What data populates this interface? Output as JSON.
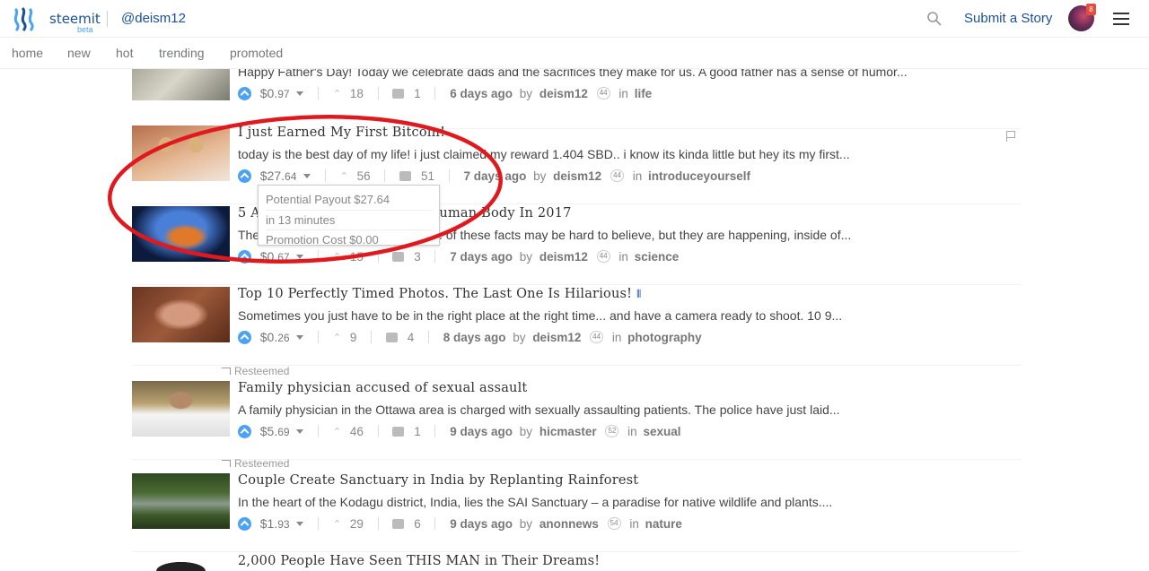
{
  "header": {
    "brand": "steemit",
    "beta": "beta",
    "username": "@deism12",
    "submit_label": "Submit a Story",
    "notification_count": "8"
  },
  "nav": {
    "items": [
      "home",
      "new",
      "hot",
      "trending",
      "promoted"
    ]
  },
  "posts": [
    {
      "title": "",
      "excerpt": "Happy Father's Day! Today we celebrate dads and the sacrifices they make for us. A good father has a sense of humor...",
      "payout_main": "$0.",
      "payout_cents": "97",
      "votes": "18",
      "comments": "1",
      "time": "6 days ago",
      "by": "by",
      "author": "deism12",
      "rep": "44",
      "in": "in",
      "category": "life"
    },
    {
      "title": "I just Earned My First Bitcoin!",
      "excerpt": "today is the best day of my life! i just claimed my reward 1.404 SBD.. i know its kinda little but hey its my first...",
      "payout_main": "$27.",
      "payout_cents": "64",
      "votes": "56",
      "comments": "51",
      "time": "7 days ago",
      "by": "by",
      "author": "deism12",
      "rep": "44",
      "in": "in",
      "category": "introduceyourself"
    },
    {
      "title": "5 Amazing Facts About The Human Body In 2017",
      "excerpt": "These facts are truly amazing. Some of these facts may be hard to believe, but they are happening, inside of...",
      "payout_main": "$0.",
      "payout_cents": "67",
      "votes": "15",
      "comments": "3",
      "time": "7 days ago",
      "by": "by",
      "author": "deism12",
      "rep": "44",
      "in": "in",
      "category": "science"
    },
    {
      "title": "Top 10 Perfectly Timed Photos. The Last One Is Hilarious!",
      "excerpt": "Sometimes you just have to be in the right place at the right time... and have a camera ready to shoot. 10 9...",
      "payout_main": "$0.",
      "payout_cents": "26",
      "votes": "9",
      "comments": "4",
      "time": "8 days ago",
      "by": "by",
      "author": "deism12",
      "rep": "44",
      "in": "in",
      "category": "photography"
    },
    {
      "resteemed": "Resteemed",
      "title": "Family physician accused of sexual assault",
      "excerpt": "A family physician in the Ottawa area is charged with sexually assaulting patients. The police have just laid...",
      "payout_main": "$5.",
      "payout_cents": "69",
      "votes": "46",
      "comments": "1",
      "time": "9 days ago",
      "by": "by",
      "author": "hicmaster",
      "rep": "52",
      "in": "in",
      "category": "sexual"
    },
    {
      "resteemed": "Resteemed",
      "title": "Couple Create Sanctuary in India by Replanting Rainforest",
      "excerpt": "In the heart of the Kodagu district, India, lies the SAI Sanctuary – a paradise for native wildlife and plants....",
      "payout_main": "$1.",
      "payout_cents": "93",
      "votes": "29",
      "comments": "6",
      "time": "9 days ago",
      "by": "by",
      "author": "anonnews",
      "rep": "54",
      "in": "in",
      "category": "nature"
    },
    {
      "title": "2,000 People Have Seen THIS MAN in Their Dreams!"
    }
  ],
  "tooltip": {
    "line1": "Potential Payout $27.64",
    "line2": "in 13 minutes",
    "line3": "Promotion Cost $0.00"
  },
  "colors": {
    "brand": "#1a5099",
    "upvote": "#4ba2f2",
    "annotation": "#e0191e"
  }
}
